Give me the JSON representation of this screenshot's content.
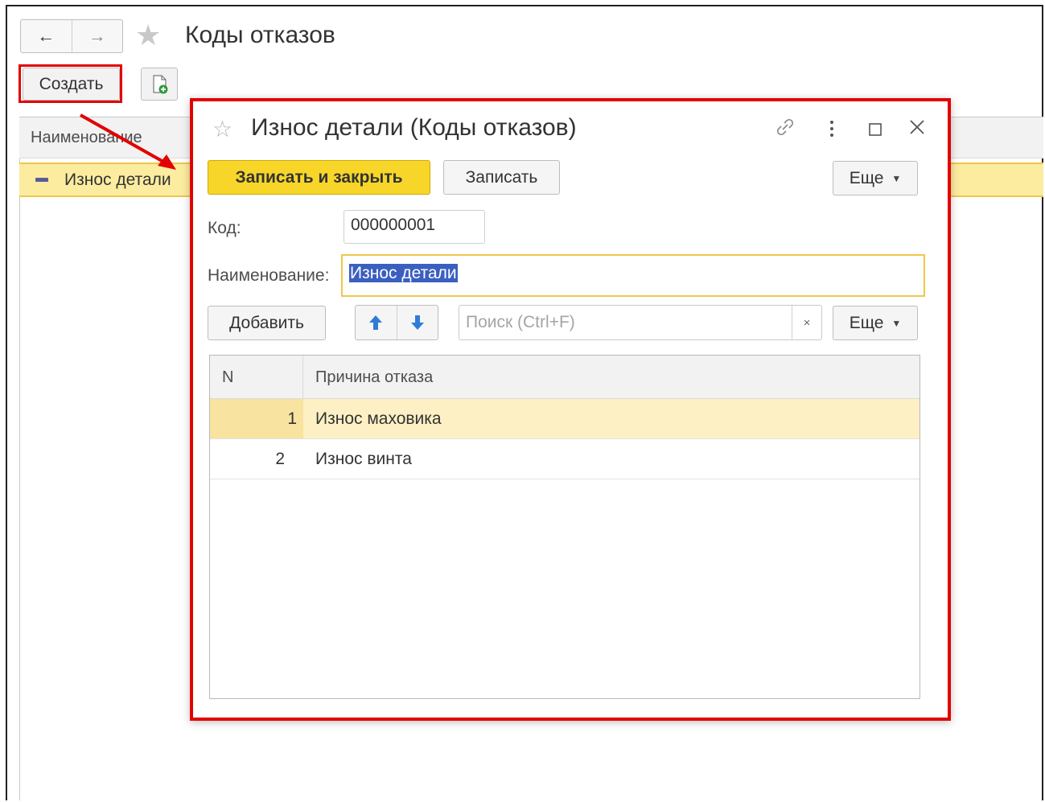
{
  "main": {
    "title": "Коды отказов",
    "nav": {
      "back": "←",
      "forward": "→"
    },
    "toolbar": {
      "create_label": "Создать"
    },
    "list": {
      "header": "Наименование",
      "rows": [
        {
          "label": "Износ детали"
        }
      ]
    }
  },
  "dialog": {
    "title": "Износ детали (Коды отказов)",
    "buttons": {
      "save_close": "Записать и закрыть",
      "save": "Записать",
      "more": "Еще",
      "add": "Добавить",
      "more2": "Еще"
    },
    "fields": {
      "code_label": "Код:",
      "code_value": "000000001",
      "name_label": "Наименование:",
      "name_value": "Износ детали"
    },
    "search": {
      "placeholder": "Поиск (Ctrl+F)",
      "clear": "×"
    },
    "table": {
      "columns": [
        "N",
        "Причина отказа"
      ],
      "rows": [
        {
          "n": "1",
          "reason": "Износ маховика",
          "selected": true
        },
        {
          "n": "2",
          "reason": "Износ винта",
          "selected": false
        }
      ]
    }
  },
  "colors": {
    "highlight": "#e30000",
    "accent_yellow": "#f7d629",
    "row_selected": "#fbec9f"
  },
  "icons": [
    "back-arrow-icon",
    "forward-arrow-icon",
    "favorite-star-icon",
    "copy-create-icon",
    "link-icon",
    "more-vertical-icon",
    "maximize-icon",
    "close-icon",
    "arrow-up-icon",
    "arrow-down-icon",
    "clear-search-icon"
  ]
}
